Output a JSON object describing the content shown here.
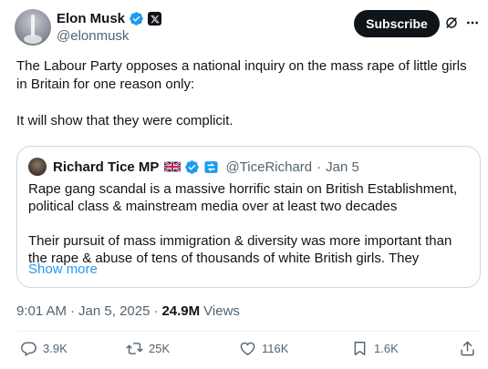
{
  "author": {
    "name": "Elon Musk",
    "handle": "@elonmusk",
    "avatar_icon": "rocket-launch-avatar"
  },
  "header": {
    "subscribe_label": "Subscribe",
    "grok_icon": "grok-icon",
    "more_icon": "more-dots-icon"
  },
  "tweet": {
    "paragraphs": [
      "The Labour Party opposes a national inquiry on the mass rape of little girls in Britain for one reason only:",
      "It will show that they were complicit."
    ]
  },
  "quote": {
    "name": "Richard Tice MP",
    "handle": "@TiceRichard",
    "sep": "·",
    "date": "Jan 5",
    "paragraphs": [
      "Rape gang scandal is a massive horrific stain on British Establishment, political class & mainstream media over at least two decades",
      "Their pursuit of mass immigration & diversity was more important than the rape & abuse of tens of thousands of white British girls. They"
    ],
    "show_more": "Show more"
  },
  "meta": {
    "time": "9:01 AM",
    "sep1": "·",
    "date": "Jan 5, 2025",
    "sep2": "·",
    "views_count": "24.9M",
    "views_label": "Views"
  },
  "actions": {
    "replies": "3.9K",
    "reposts": "25K",
    "likes": "116K",
    "bookmarks": "1.6K"
  },
  "colors": {
    "text": "#0f1419",
    "secondary": "#536471",
    "link": "#1d9bf0",
    "verified": "#1d9bf0",
    "border": "#cfd9de"
  }
}
